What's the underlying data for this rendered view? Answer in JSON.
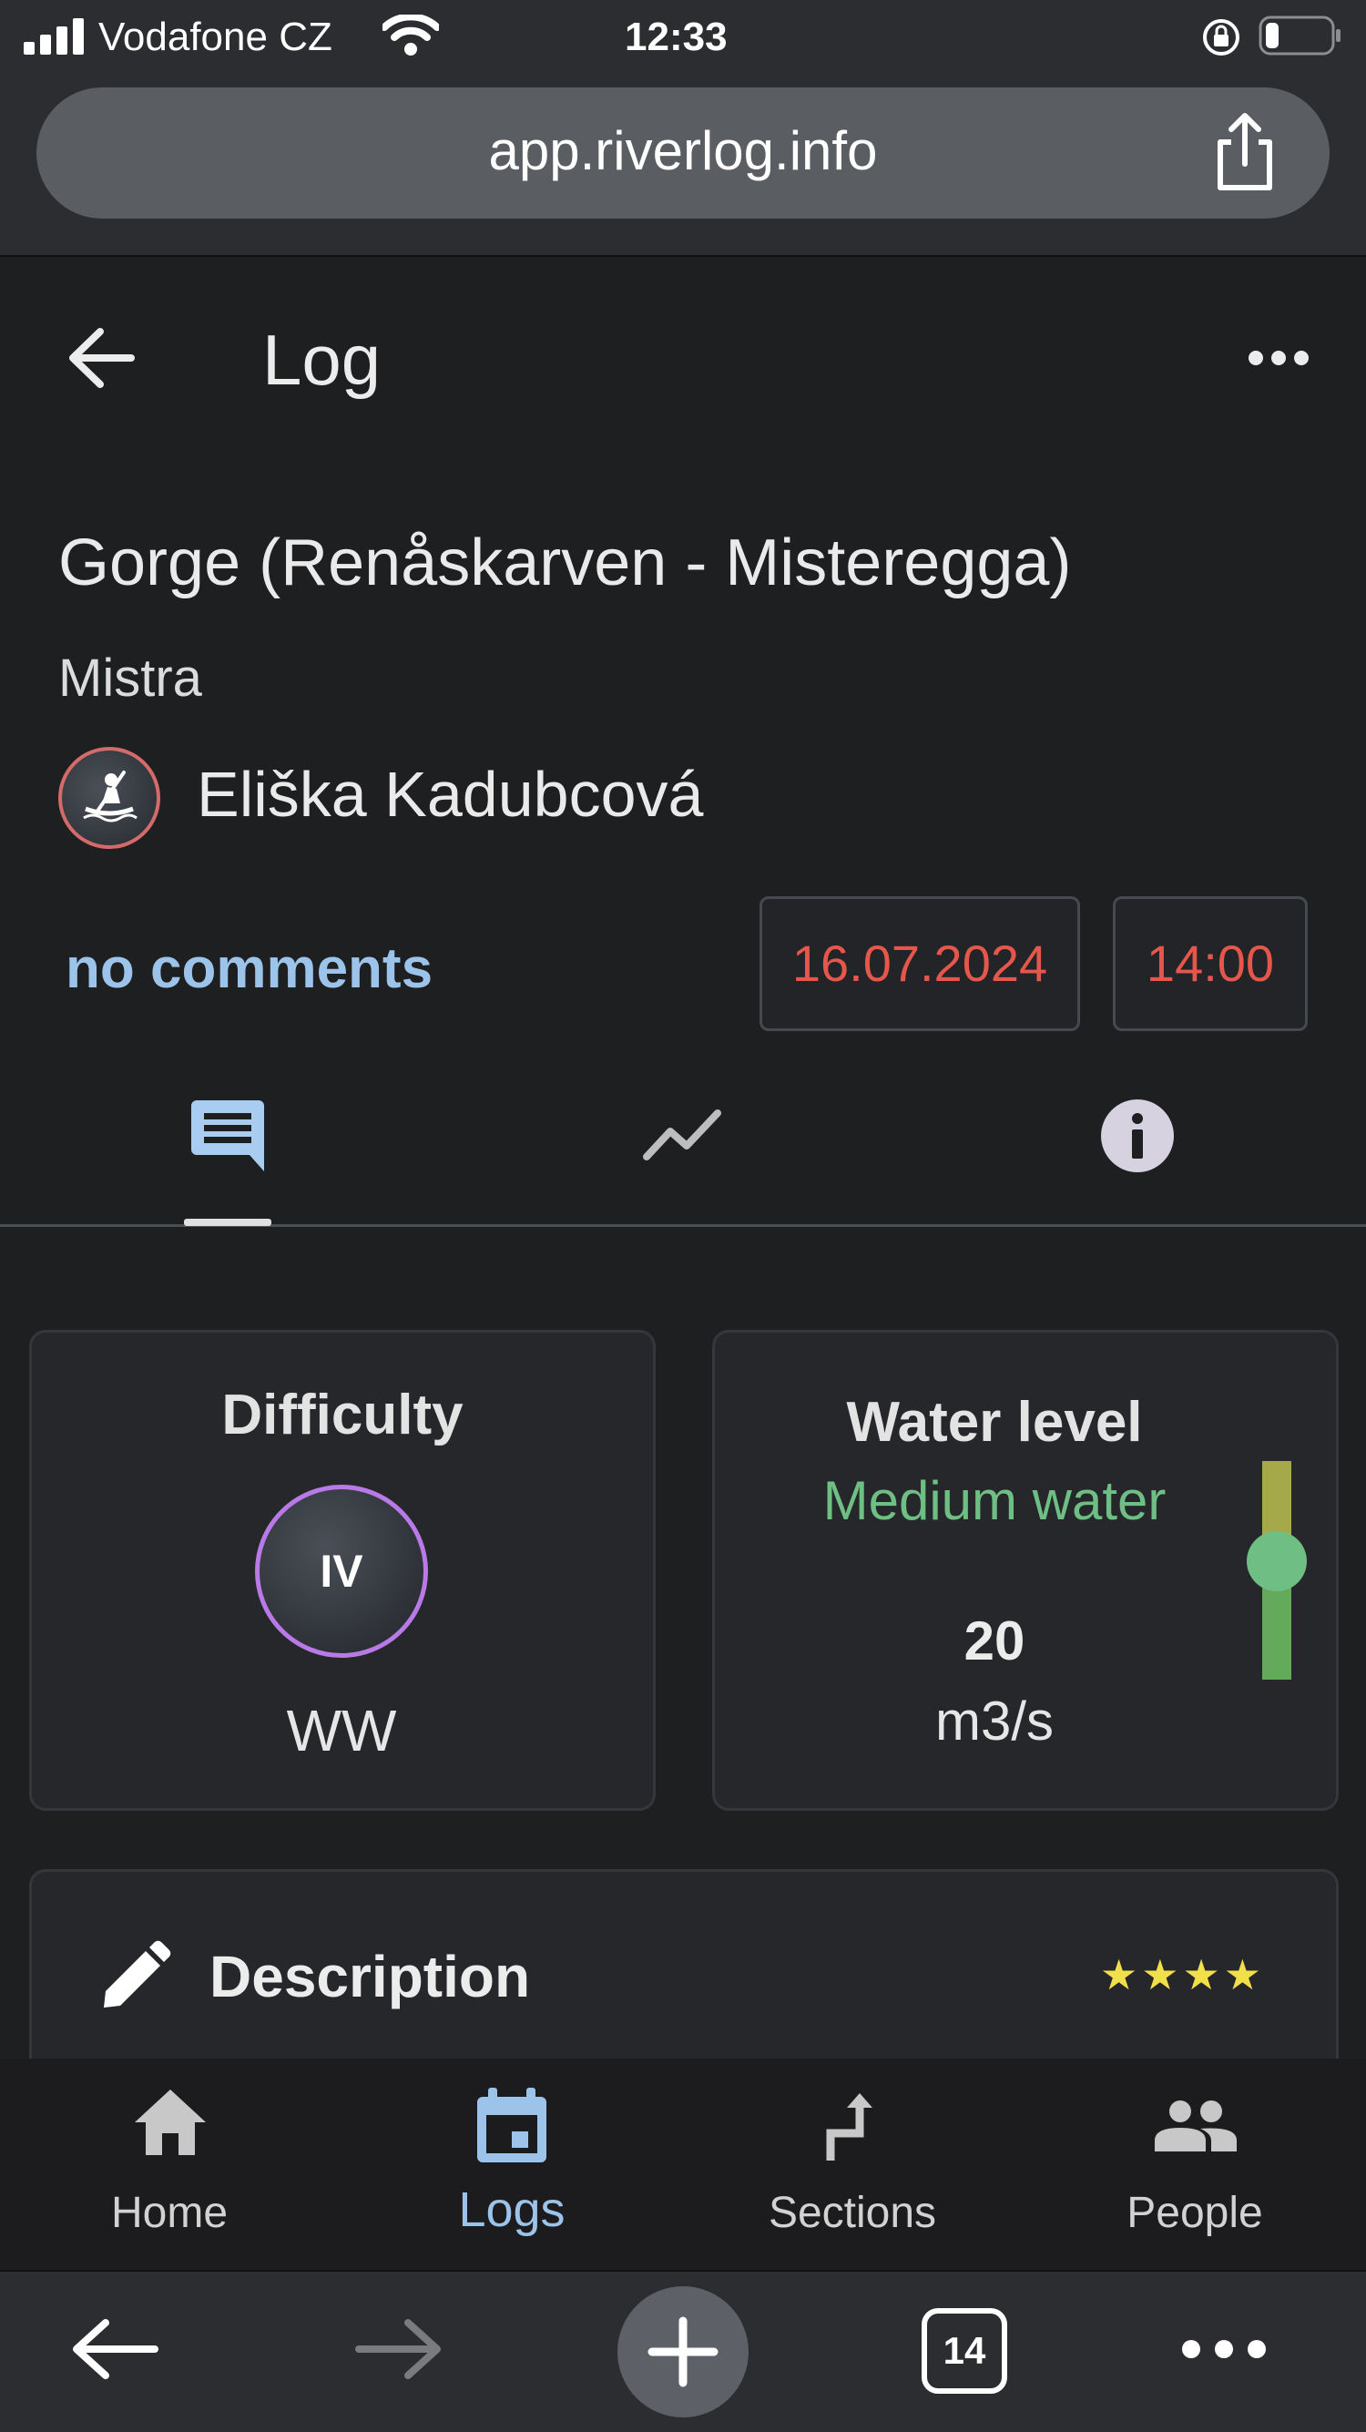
{
  "status_bar": {
    "carrier": "Vodafone CZ",
    "time": "12:33"
  },
  "browser": {
    "url": "app.riverlog.info",
    "tab_count": "14"
  },
  "header": {
    "title": "Log"
  },
  "log": {
    "section": "Gorge (Renåskarven - Misteregga)",
    "river": "Mistra",
    "user": "Eliška Kadubcová",
    "comments": "no comments",
    "date": "16.07.2024",
    "time": "14:00"
  },
  "tabs": [
    {
      "icon": "comment-icon",
      "active": true
    },
    {
      "icon": "chart-line-icon",
      "active": false
    },
    {
      "icon": "info-icon",
      "active": false
    }
  ],
  "difficulty": {
    "label": "Difficulty",
    "grade": "IV",
    "type": "WW"
  },
  "water_level": {
    "label": "Water level",
    "status": "Medium water",
    "flow": "20",
    "unit": "m3/s",
    "level_fraction": 0.54
  },
  "description": {
    "label": "Description",
    "stars": "★★★★",
    "rating": 4
  },
  "bottom_nav": [
    {
      "label": "Home",
      "icon": "home-icon",
      "active": false
    },
    {
      "label": "Logs",
      "icon": "calendar-icon",
      "active": true
    },
    {
      "label": "Sections",
      "icon": "section-icon",
      "active": false
    },
    {
      "label": "People",
      "icon": "people-icon",
      "active": false
    }
  ],
  "colors": {
    "accent": "#9cc3ea",
    "date_red": "#e5574b",
    "medium_green": "#6fbf85",
    "grade_purple": "#b97ae8",
    "star_yellow": "#f2e04a"
  }
}
